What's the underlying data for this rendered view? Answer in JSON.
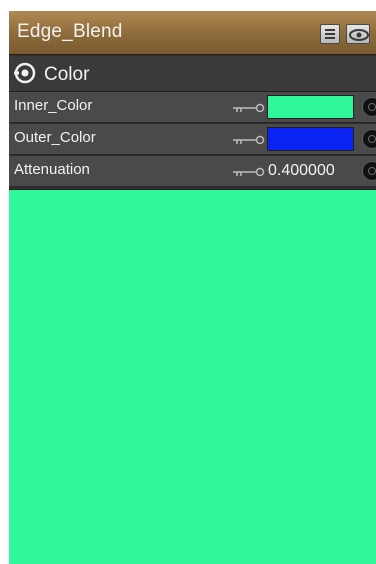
{
  "window": {
    "title": "Edge_Blend"
  },
  "title_bar": {
    "menu_icon": "menu-lines-icon",
    "eye_icon": "visibility-eye-icon",
    "background": "#8c6a3a"
  },
  "section": {
    "title": "Color",
    "icon": "target-circle-icon"
  },
  "properties": [
    {
      "label": "Inner_Color",
      "kind": "color",
      "color": "#30f799",
      "icon": "key-icon"
    },
    {
      "label": "Outer_Color",
      "kind": "color",
      "color": "#0a22f2",
      "icon": "key-icon"
    },
    {
      "label": "Attenuation",
      "kind": "number",
      "value": "0.400000",
      "icon": "key-icon"
    }
  ],
  "preview": {
    "color": "#30f799"
  }
}
